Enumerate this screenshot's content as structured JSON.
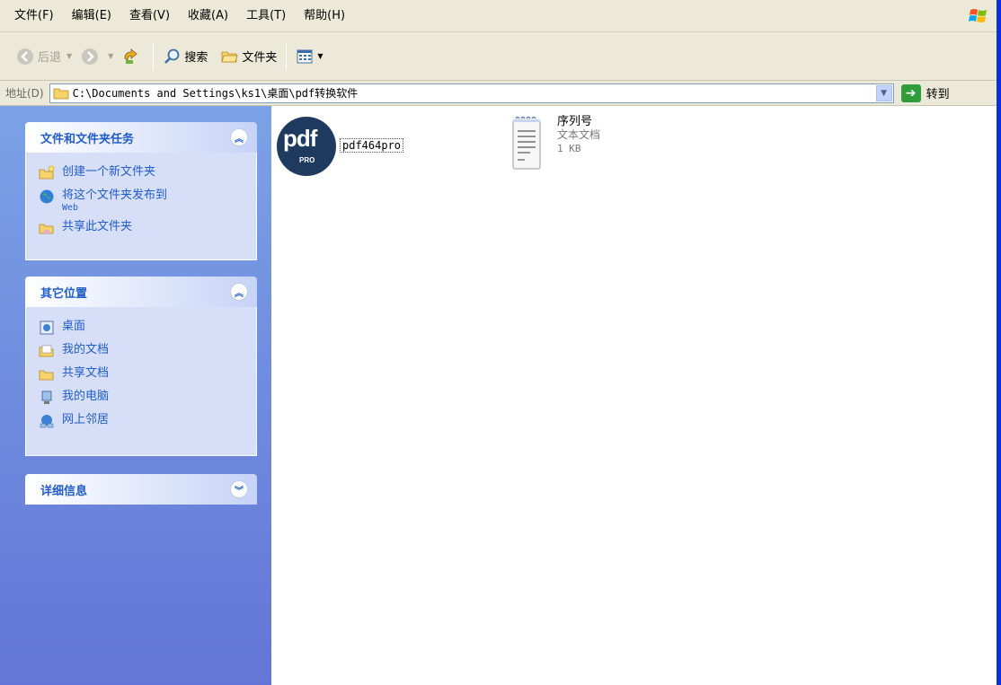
{
  "menubar": {
    "items": [
      "文件(F)",
      "编辑(E)",
      "查看(V)",
      "收藏(A)",
      "工具(T)",
      "帮助(H)"
    ]
  },
  "toolbar": {
    "back_label": "后退",
    "search_label": "搜索",
    "folders_label": "文件夹"
  },
  "address": {
    "label": "地址(D)",
    "path": "C:\\Documents and Settings\\ks1\\桌面\\pdf转换软件",
    "goto_label": "转到"
  },
  "taskpane": {
    "file_tasks": {
      "title": "文件和文件夹任务",
      "items": [
        {
          "label": "创建一个新文件夹",
          "icon": "new-folder-icon"
        },
        {
          "label": "将这个文件夹发布到",
          "sub": "Web",
          "icon": "publish-web-icon"
        },
        {
          "label": "共享此文件夹",
          "icon": "share-folder-icon"
        }
      ]
    },
    "other_places": {
      "title": "其它位置",
      "items": [
        {
          "label": "桌面",
          "icon": "desktop-icon"
        },
        {
          "label": "我的文档",
          "icon": "my-documents-icon"
        },
        {
          "label": "共享文档",
          "icon": "shared-documents-icon"
        },
        {
          "label": "我的电脑",
          "icon": "my-computer-icon"
        },
        {
          "label": "网上邻居",
          "icon": "network-places-icon"
        }
      ]
    },
    "details": {
      "title": "详细信息"
    }
  },
  "files": [
    {
      "name": "pdf464pro",
      "icon": "pdf-pro-icon"
    },
    {
      "name": "序列号",
      "type": "文本文档",
      "size": "1 KB",
      "icon": "text-document-icon"
    }
  ],
  "colors": {
    "taskpane_top": "#7ba2e7",
    "taskpane_bottom": "#6375d6",
    "panel_title": "#215dc6",
    "pdf_icon_bg": "#1e3a5f"
  }
}
